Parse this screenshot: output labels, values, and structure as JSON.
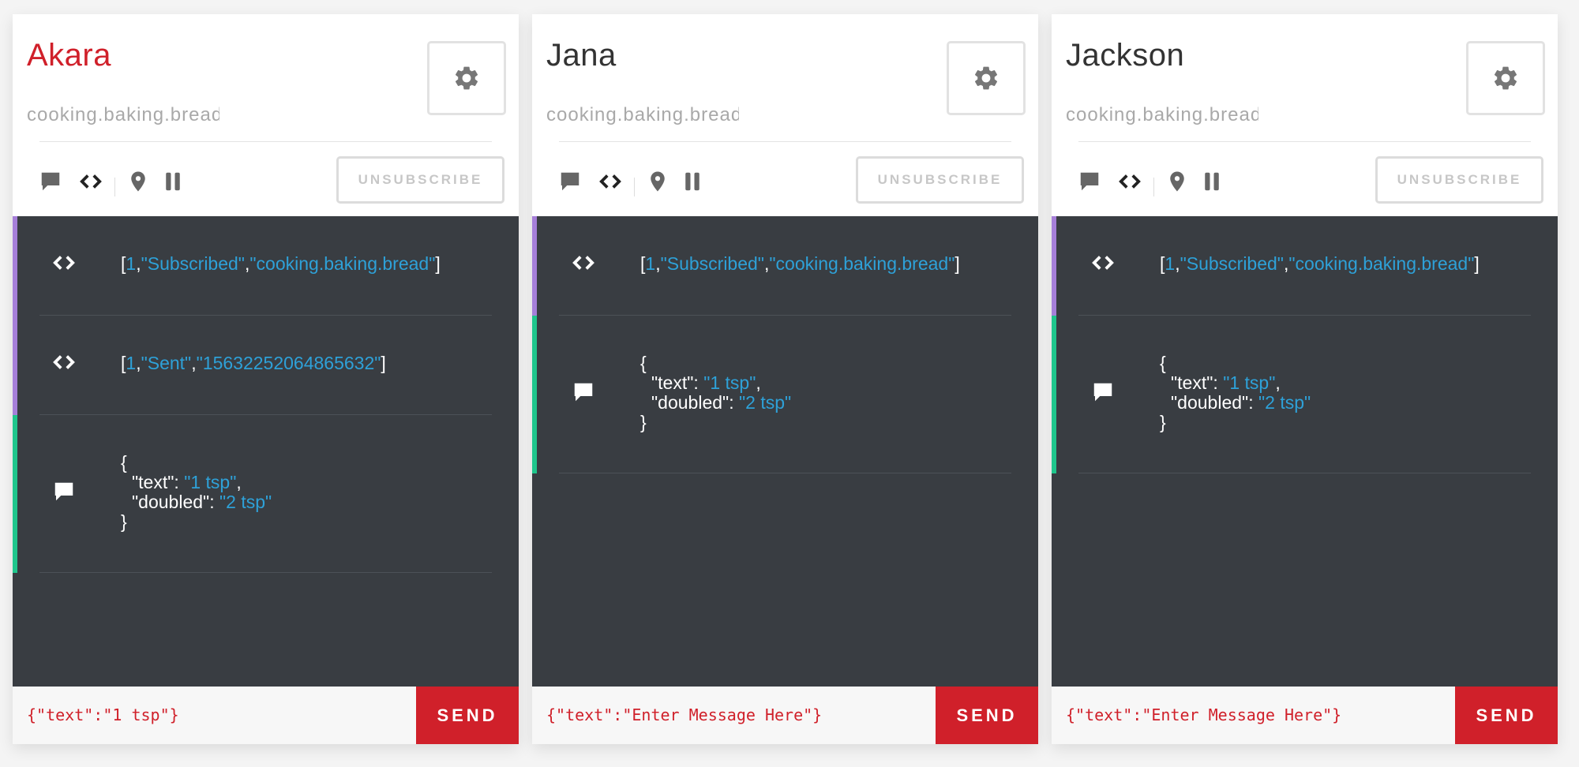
{
  "colors": {
    "accent_red": "#d0202a",
    "panel_dark": "#393d42",
    "token_blue": "#2ea1d8",
    "bar_purple": "#a67fd9",
    "bar_green": "#1fc68c"
  },
  "icons": {
    "settings": "gear-icon",
    "message": "chat-bubble-icon",
    "code": "code-brackets-icon",
    "location": "location-pin-icon",
    "pause": "pause-icon"
  },
  "cards": [
    {
      "name": "Akara",
      "channel": "cooking.baking.bread",
      "unsubscribe_label": "UNSUBSCRIBE",
      "messages": {
        "subscribed": {
          "open": "[",
          "num": "1",
          "a": "\"Subscribed\"",
          "comma1": ",",
          "comma2": ",",
          "b": "\"cooking.baking.bread\"",
          "close": "]"
        },
        "sent": {
          "open": "[",
          "num": "1",
          "a": "\"Sent\"",
          "comma1": ",",
          "comma2": ",",
          "b": "\"15632252064865632\"",
          "close": "]"
        },
        "json": {
          "open": "{",
          "text_key": "\"text\": ",
          "text_val": "\"1 tsp\"",
          "comma": ",",
          "doubled_key": "\"doubled\": ",
          "doubled_val": "\"2 tsp\"",
          "close": "}"
        }
      },
      "input_value": "{\"text\":\"1 tsp\"}",
      "send_label": "SEND"
    },
    {
      "name": "Jana",
      "channel": "cooking.baking.bread",
      "unsubscribe_label": "UNSUBSCRIBE",
      "messages": {
        "subscribed": {
          "open": "[",
          "num": "1",
          "a": "\"Subscribed\"",
          "comma1": ",",
          "comma2": ",",
          "b": "\"cooking.baking.bread\"",
          "close": "]"
        },
        "json": {
          "open": "{",
          "text_key": "\"text\": ",
          "text_val": "\"1 tsp\"",
          "comma": ",",
          "doubled_key": "\"doubled\": ",
          "doubled_val": "\"2 tsp\"",
          "close": "}"
        }
      },
      "input_value": "{\"text\":\"Enter Message Here\"}",
      "send_label": "SEND"
    },
    {
      "name": "Jackson",
      "channel": "cooking.baking.bread",
      "unsubscribe_label": "UNSUBSCRIBE",
      "messages": {
        "subscribed": {
          "open": "[",
          "num": "1",
          "a": "\"Subscribed\"",
          "comma1": ",",
          "comma2": ",",
          "b": "\"cooking.baking.bread\"",
          "close": "]"
        },
        "json": {
          "open": "{",
          "text_key": "\"text\": ",
          "text_val": "\"1 tsp\"",
          "comma": ",",
          "doubled_key": "\"doubled\": ",
          "doubled_val": "\"2 tsp\"",
          "close": "}"
        }
      },
      "input_value": "{\"text\":\"Enter Message Here\"}",
      "send_label": "SEND"
    }
  ]
}
